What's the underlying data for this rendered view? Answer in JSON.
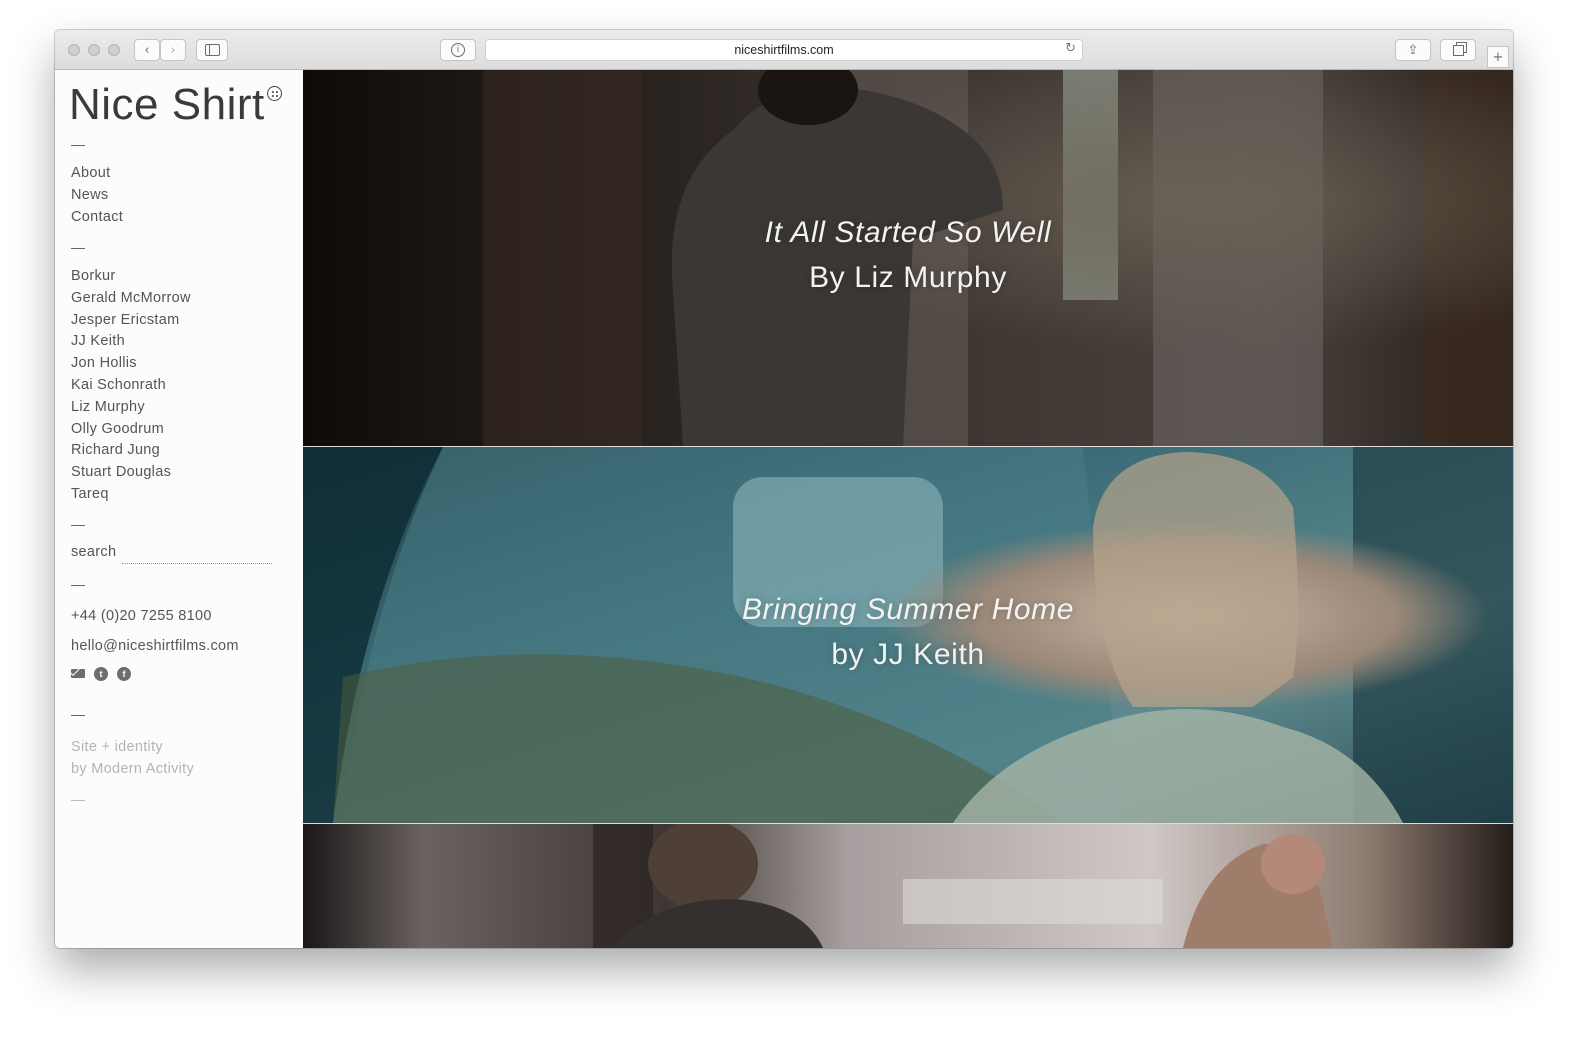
{
  "browser": {
    "url": "niceshirtfilms.com"
  },
  "site": {
    "logo": "Nice Shirt",
    "nav_primary": [
      "About",
      "News",
      "Contact"
    ],
    "directors": [
      "Borkur",
      "Gerald McMorrow",
      "Jesper Ericstam",
      "JJ Keith",
      "Jon Hollis",
      "Kai Schonrath",
      "Liz Murphy",
      "Olly Goodrum",
      "Richard Jung",
      "Stuart Douglas",
      "Tareq"
    ],
    "search_label": "search",
    "phone": "+44 (0)20 7255 8100",
    "email": "hello@niceshirtfilms.com",
    "social_icons": [
      "mail-icon",
      "twitter-icon",
      "facebook-icon"
    ],
    "credit_line1": "Site + identity",
    "credit_line2": "by Modern Activity"
  },
  "films": [
    {
      "title": "It All Started So Well",
      "byline": "By Liz Murphy"
    },
    {
      "title": "Bringing Summer Home",
      "byline": "by JJ Keith"
    }
  ],
  "colors": {
    "sidebar_bg": "#fcfcfc",
    "text": "#555555",
    "credit": "#b4b4b4"
  }
}
